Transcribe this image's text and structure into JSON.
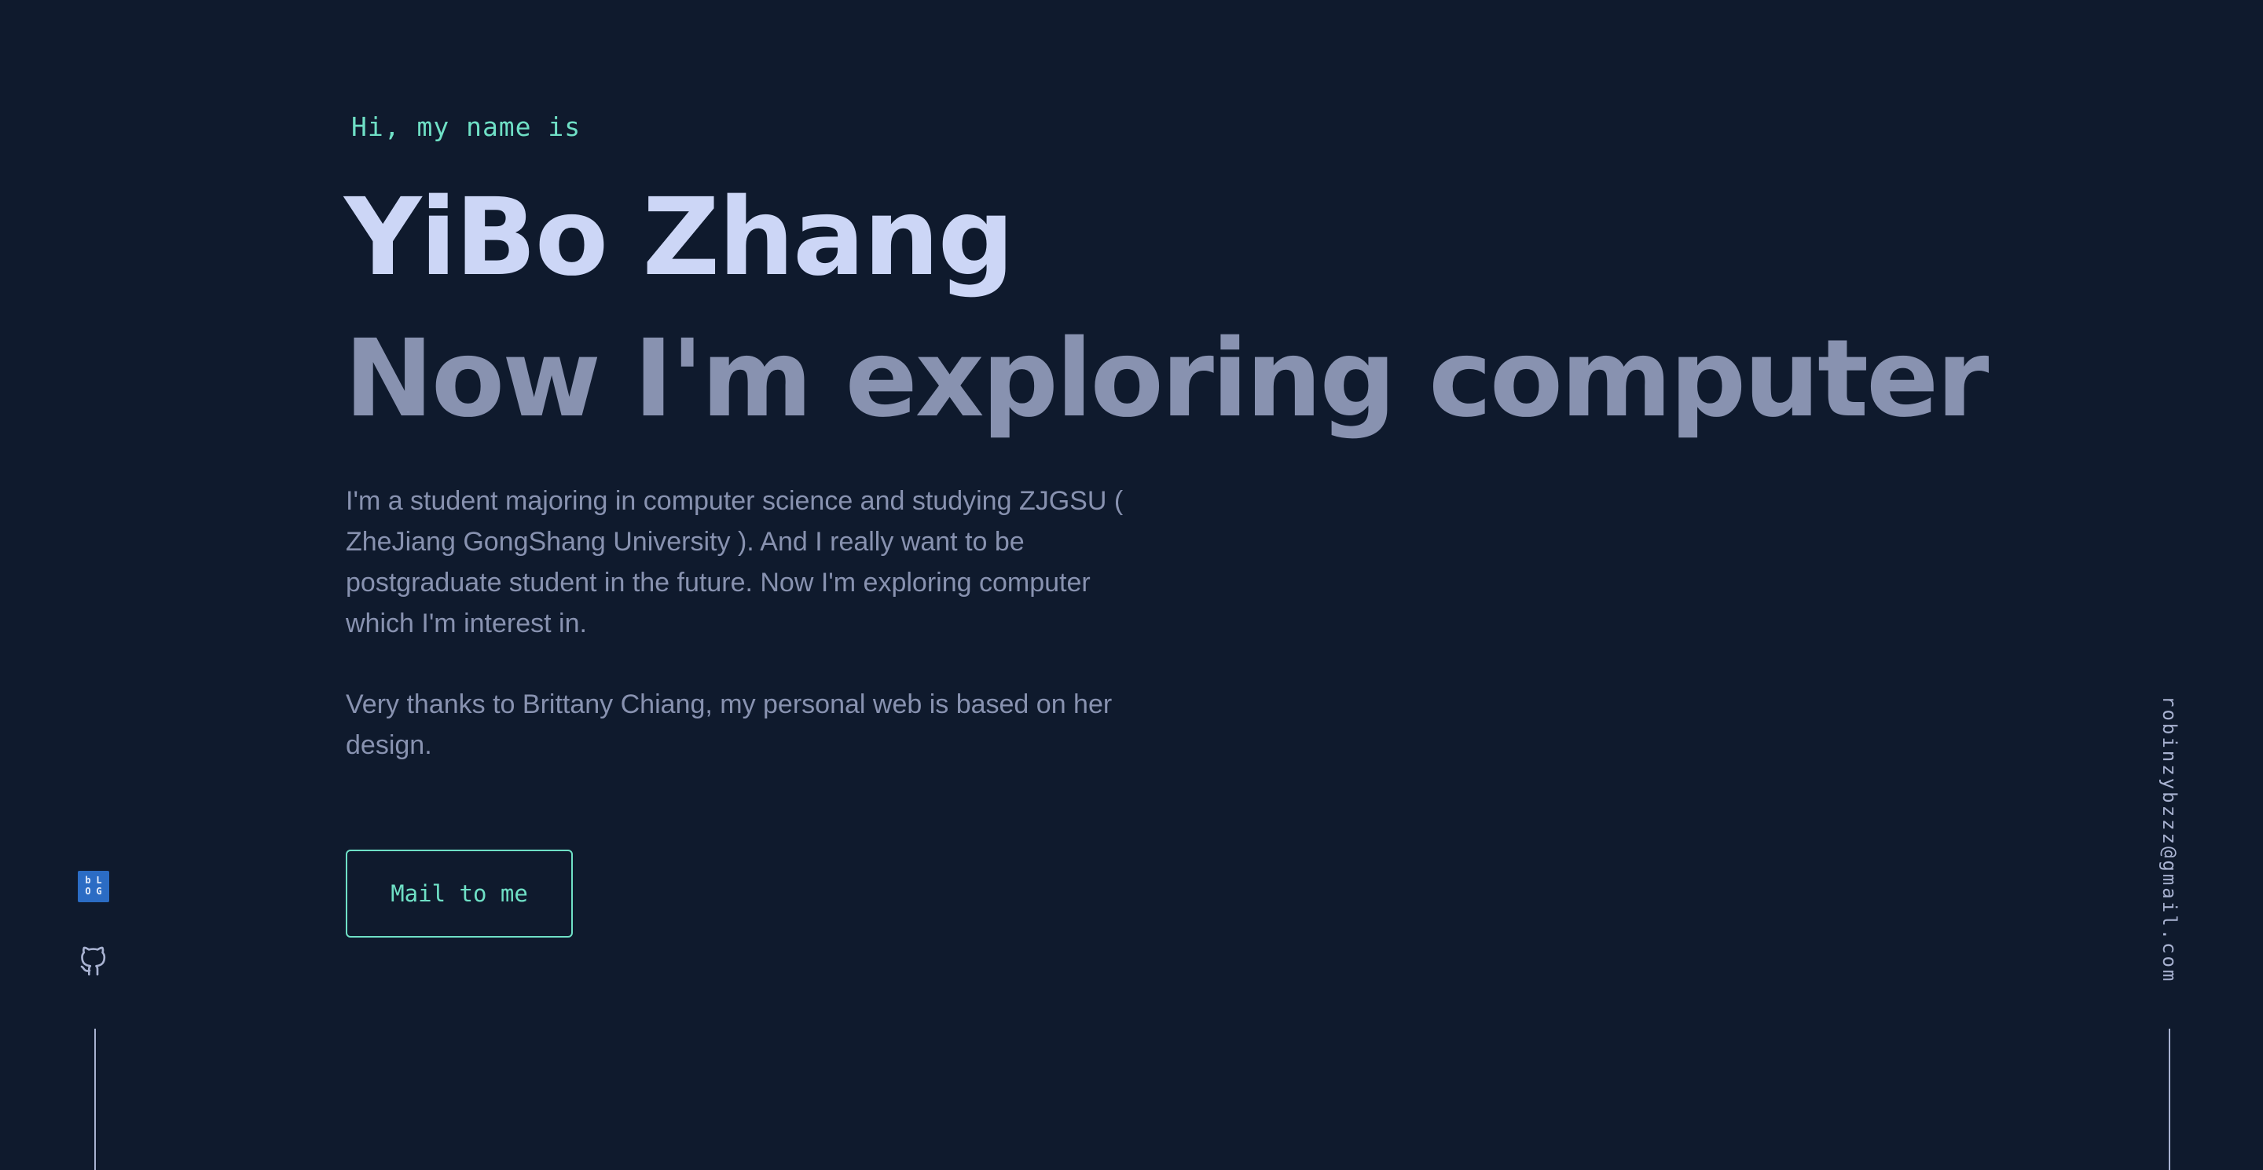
{
  "hero": {
    "greeting": "Hi, my name is",
    "name": "YiBo Zhang",
    "tagline": "Now I'm exploring computer",
    "bio": "I'm a student majoring in computer science and studying ZJGSU ( ZheJiang GongShang University ). And I really want to be postgraduate student in the future. Now I'm exploring computer which I'm interest in.",
    "thanks": "Very thanks to Brittany Chiang, my personal web is based on her design.",
    "cta_label": "Mail to me"
  },
  "social": {
    "items": [
      {
        "icon": "blog-icon"
      },
      {
        "icon": "github-icon"
      }
    ]
  },
  "email": {
    "address": "robinzybzzz@gmail.com"
  },
  "colors": {
    "background": "#0f1a2d",
    "accent": "#6fe0c6",
    "heading": "#ccd6f6",
    "muted": "#8892b0",
    "blog_icon": "#2b6cc4"
  }
}
